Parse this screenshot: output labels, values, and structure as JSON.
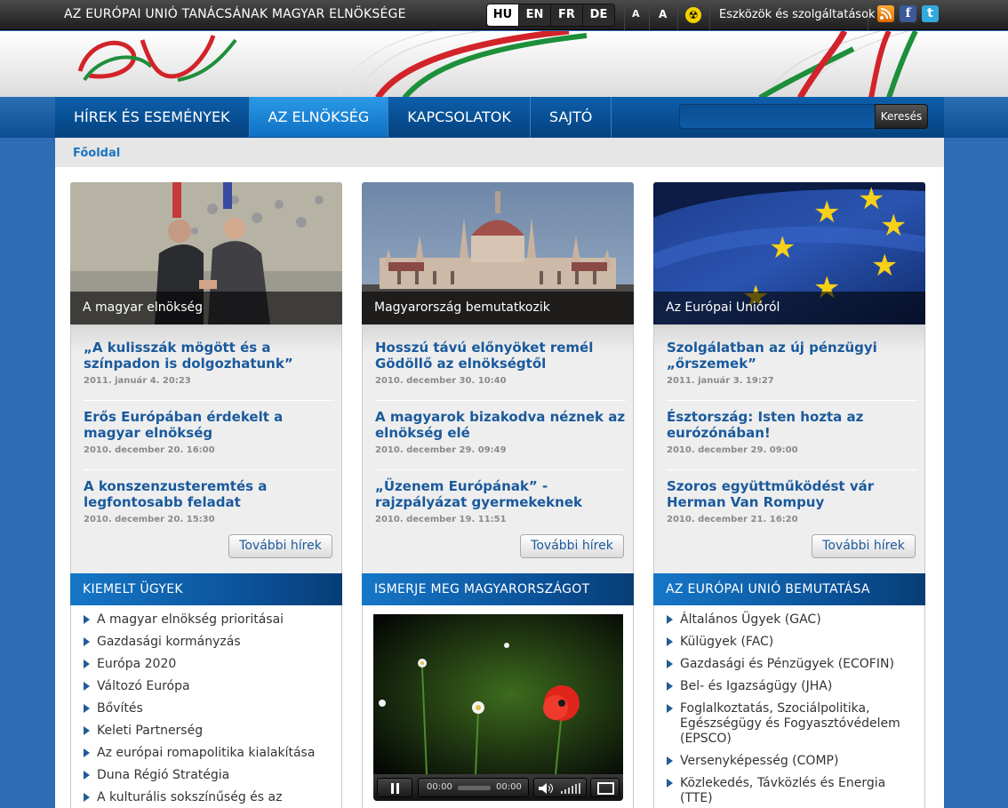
{
  "topbar": {
    "site_title": "AZ EURÓPAI UNIÓ TANÁCSÁNAK MAGYAR ELNÖKSÉGE",
    "languages": [
      "HU",
      "EN",
      "FR",
      "DE"
    ],
    "active_language": "HU",
    "font_small": "A",
    "font_large": "A",
    "tools_link": "Eszközök és szolgáltatások"
  },
  "nav": {
    "items": [
      "HÍREK ÉS ESEMÉNYEK",
      "AZ ELNÖKSÉG",
      "KAPCSOLATOK",
      "SAJTÓ"
    ],
    "active": "AZ ELNÖKSÉG",
    "search_button": "Keresés",
    "search_value": ""
  },
  "breadcrumb": "Főoldal",
  "columns": [
    {
      "photo_caption": "A magyar elnökség",
      "news": [
        {
          "title": "„A kulisszák mögött és a színpadon is dolgozhatunk”",
          "date": "2011. január 4. 20:23"
        },
        {
          "title": "Erős Európában érdekelt a magyar elnökség",
          "date": "2010. december 20. 16:00"
        },
        {
          "title": "A konszenzusteremtés a legfontosabb feladat",
          "date": "2010. december 20. 15:30"
        }
      ],
      "more": "További hírek",
      "section_title": "KIEMELT ÜGYEK",
      "links": [
        "A magyar elnökség prioritásai",
        "Gazdasági kormányzás",
        "Európa 2020",
        "Változó Európa",
        "Bővítés",
        "Keleti Partnerség",
        "Az európai romapolitika kialakítása",
        "Duna Régió Stratégia",
        "A kulturális sokszínűség és az"
      ]
    },
    {
      "photo_caption": "Magyarország bemutatkozik",
      "news": [
        {
          "title": "Hosszú távú előnyöket remél Gödöllő az elnökségtől",
          "date": "2010. december 30. 10:40"
        },
        {
          "title": "A magyarok bizakodva néznek az elnökség elé",
          "date": "2010. december 29. 09:49"
        },
        {
          "title": "„Üzenem Európának” - rajzpályázat gyermekeknek",
          "date": "2010. december 19. 11:51"
        }
      ],
      "more": "További hírek",
      "section_title": "ISMERJE MEG MAGYARORSZÁGOT",
      "video": {
        "time_current": "00:00",
        "time_total": "00:00"
      }
    },
    {
      "photo_caption": "Az Európai Unióról",
      "news": [
        {
          "title": "Szolgálatban az új pénzügyi „őrszemek”",
          "date": "2011. január 3. 19:27"
        },
        {
          "title": "Észtország: Isten hozta az eurózónában!",
          "date": "2010. december 29. 09:00"
        },
        {
          "title": "Szoros együttműködést vár Herman Van Rompuy",
          "date": "2010. december 21. 16:20"
        }
      ],
      "more": "További hírek",
      "section_title": "AZ EURÓPAI UNIÓ BEMUTATÁSA",
      "links": [
        "Általános Ügyek (GAC)",
        "Külügyek (FAC)",
        "Gazdasági és Pénzügyek (ECOFIN)",
        "Bel- és Igazságügy (JHA)",
        "Foglalkoztatás, Szociálpolitika, Egészségügy és Fogyasztóvédelem (EPSCO)",
        "Versenyképesség (COMP)",
        "Közlekedés, Távközlés és Energia (TTE)"
      ]
    }
  ],
  "colors": {
    "nav_blue": "#0d5fac",
    "nav_active": "#1f8fe0",
    "link_blue": "#1a5a9c",
    "background": "#2e6cb5"
  }
}
